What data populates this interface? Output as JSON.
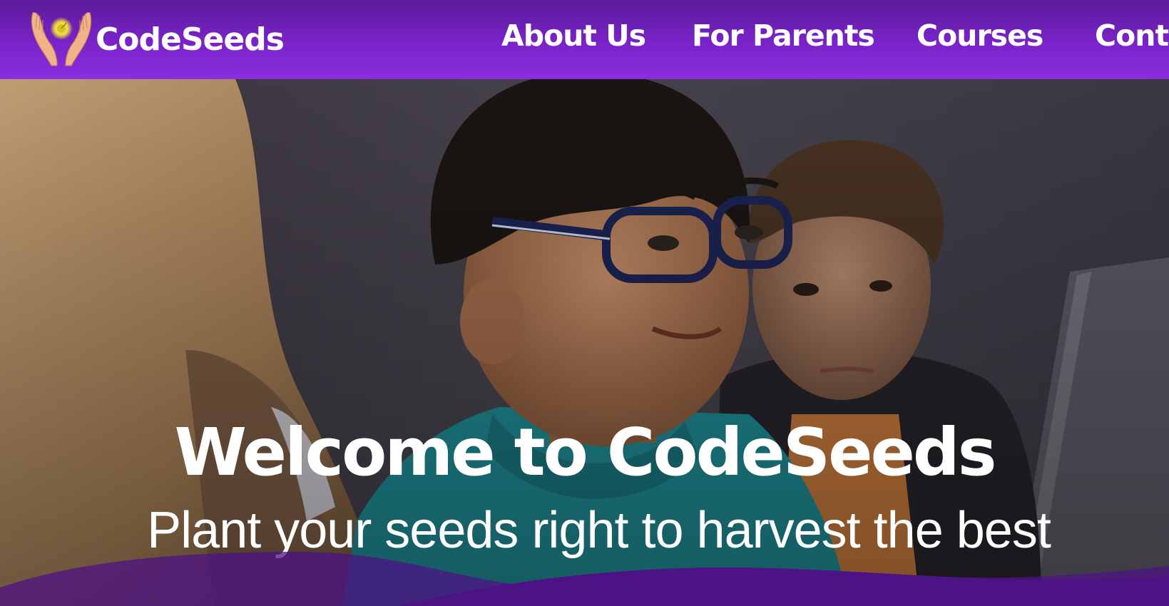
{
  "header": {
    "brand_name": "CodeSeeds",
    "logo_icon": "hands-holding-seed-icon",
    "nav": [
      {
        "label": "About Us"
      },
      {
        "label": "For Parents"
      },
      {
        "label": "Courses"
      },
      {
        "label": "Cont"
      }
    ]
  },
  "hero": {
    "title": "Welcome to CodeSeeds",
    "subtitle": "Plant your seeds right to harvest the best",
    "image": "children-at-computer-photo"
  },
  "colors": {
    "nav_top": "#5a1c9b",
    "nav_bottom": "#8b2ee0",
    "wave": "#4d1385",
    "text": "#ffffff"
  }
}
